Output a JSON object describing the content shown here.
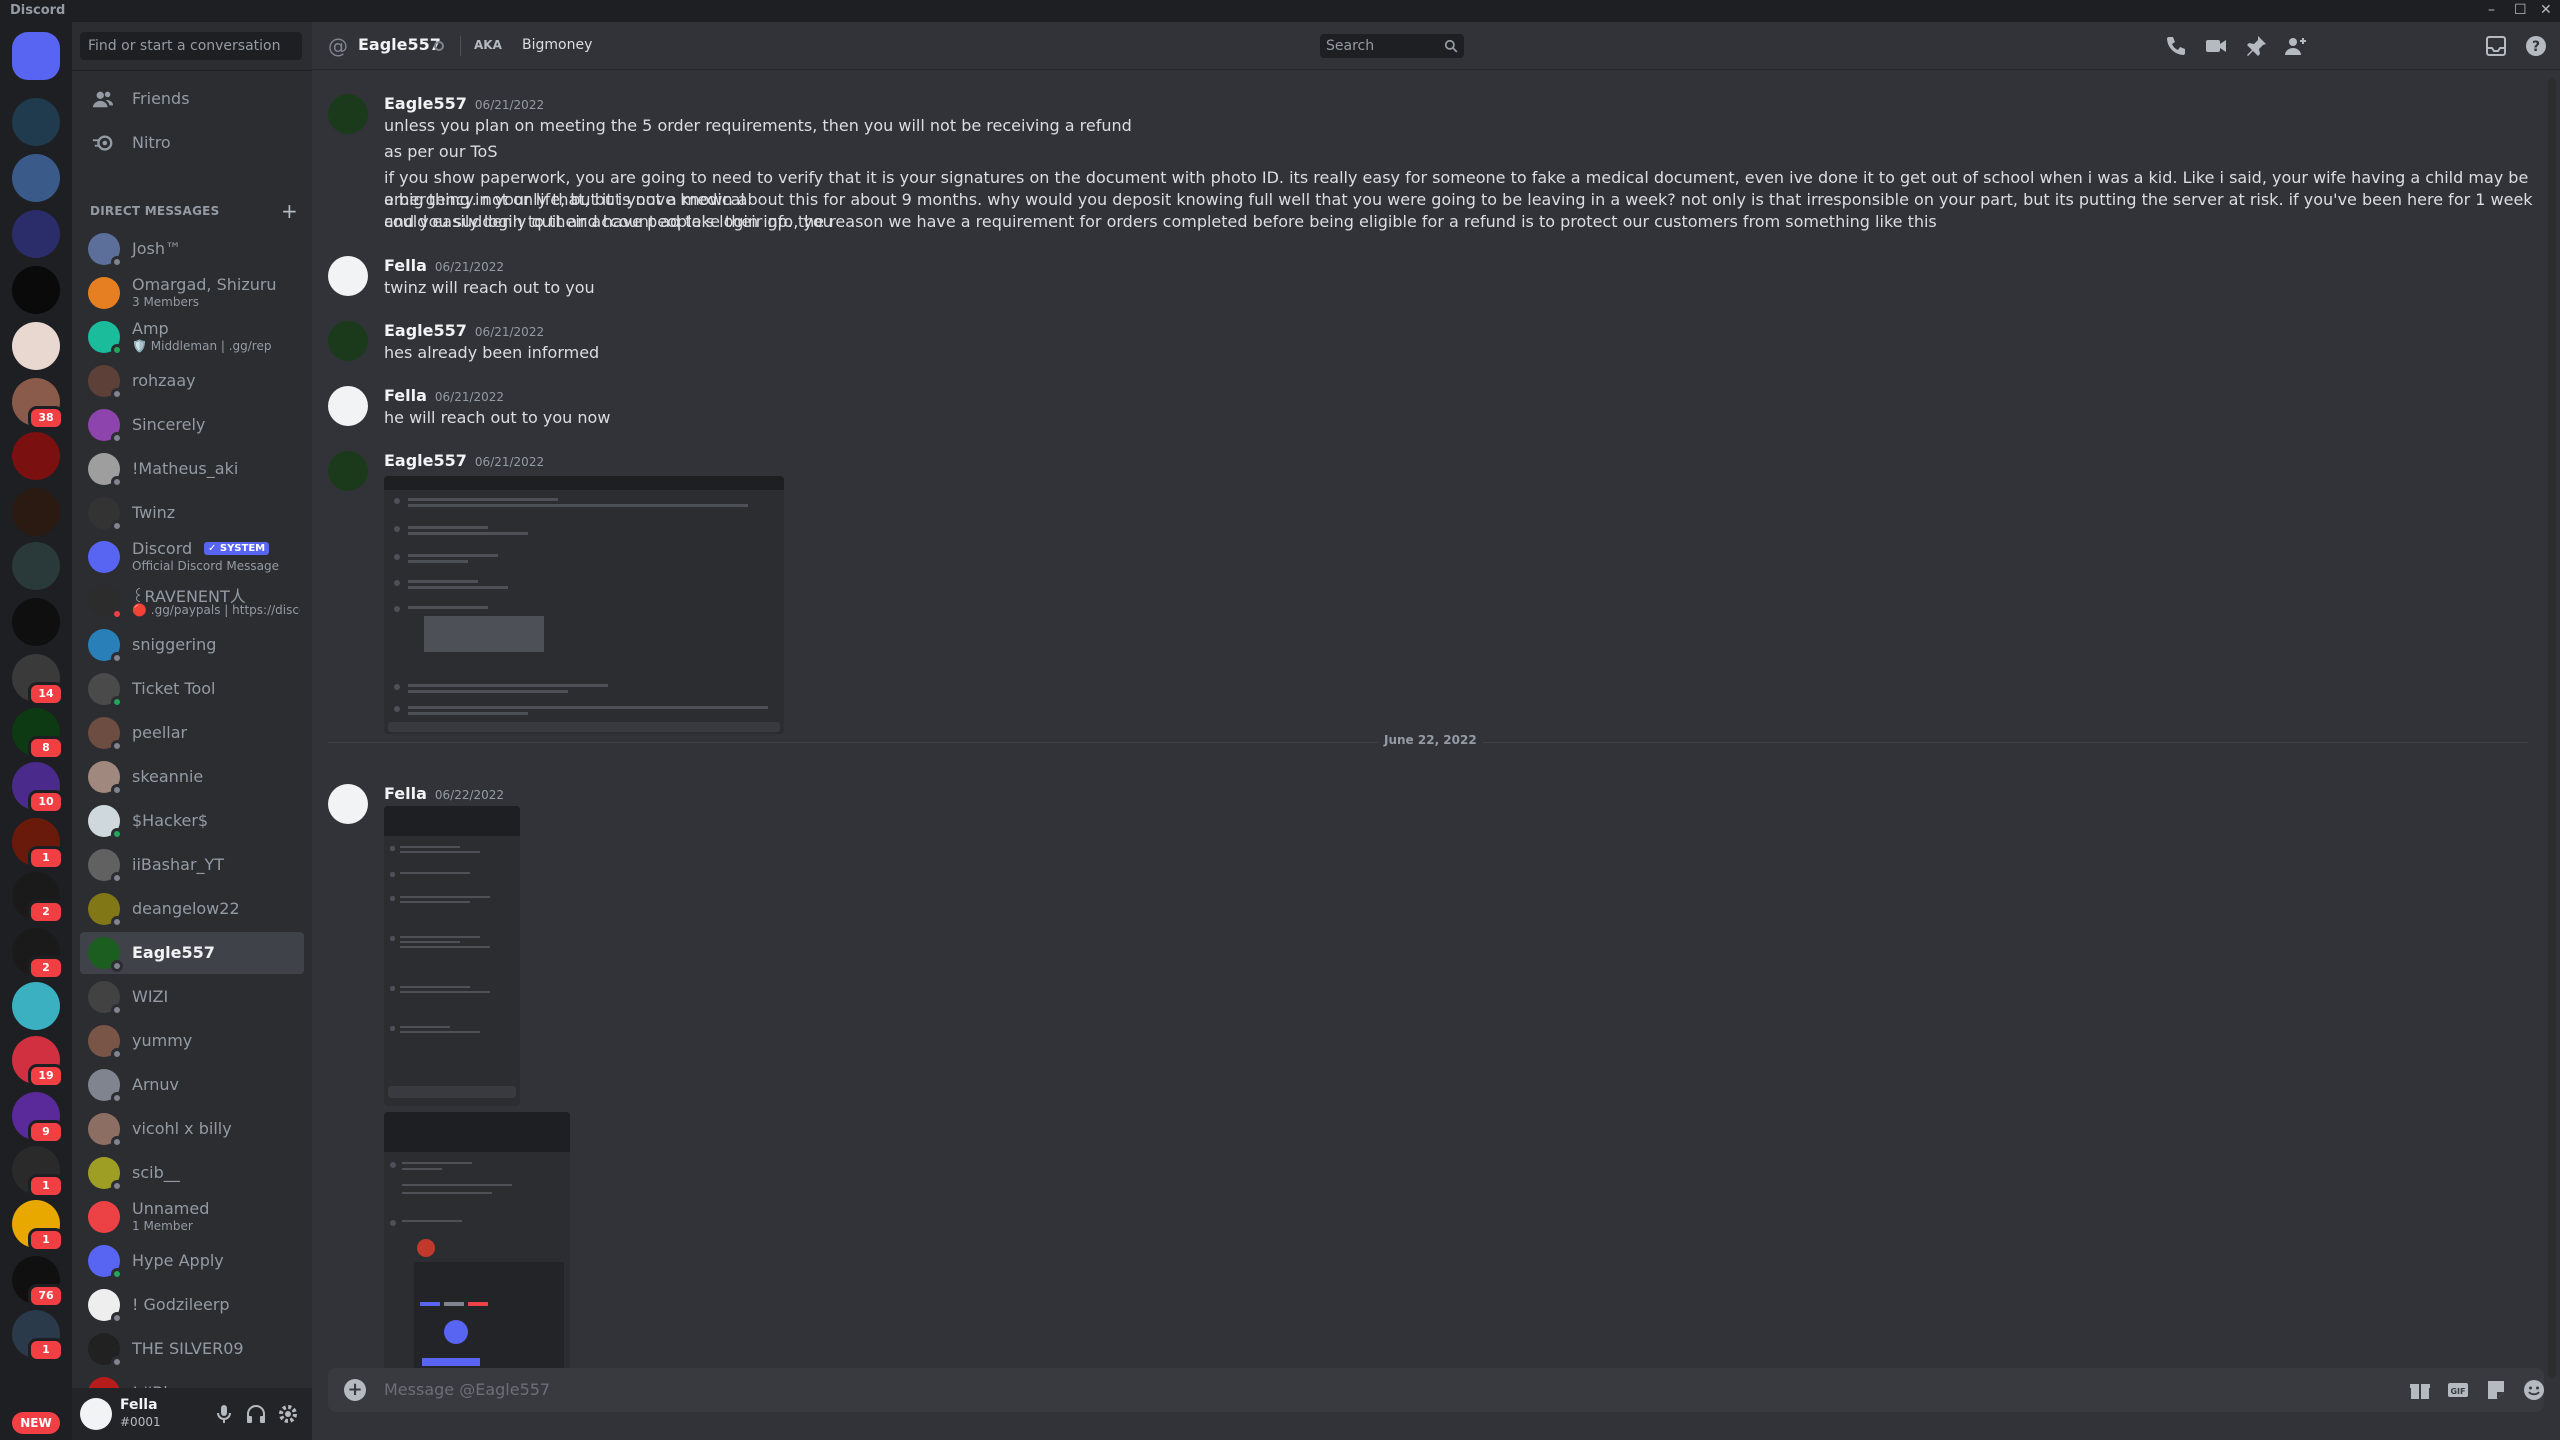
{
  "window": {
    "app_name": "Discord",
    "minimize": "–",
    "maximize": "☐",
    "close": "✕"
  },
  "sidebar": {
    "search_placeholder": "Find or start a conversation",
    "nav": [
      {
        "label": "Friends",
        "icon": "friends-icon"
      },
      {
        "label": "Nitro",
        "icon": "nitro-icon"
      }
    ],
    "dm_header": "DIRECT MESSAGES",
    "dm_add": "+",
    "dms": [
      {
        "name": "Josh™",
        "color": "#5b6f9a",
        "status": "offline"
      },
      {
        "name": "Omargad, Shizuru",
        "sub": "3 Members",
        "color": "#e67e22",
        "status": "none"
      },
      {
        "name": "Amp",
        "sub": "🛡️ Middleman | .gg/rep",
        "color": "#1abc9c",
        "status": "online"
      },
      {
        "name": "rohzaay",
        "color": "#5d4037",
        "status": "offline"
      },
      {
        "name": "Sincerely",
        "color": "#8e44ad",
        "status": "offline"
      },
      {
        "name": "!Matheus_aki",
        "color": "#9e9e9e",
        "status": "offline"
      },
      {
        "name": "Twinz",
        "color": "#333333",
        "status": "offline"
      },
      {
        "name": "Discord",
        "sub": "Official Discord Message",
        "badge": "✓ SYSTEM",
        "color": "#5865f2",
        "status": "none"
      },
      {
        "name": "꒰RAVENENT人",
        "sub": "🔴 .gg/paypals | https://discor...",
        "color": "#2c2c2c",
        "status": "dnd"
      },
      {
        "name": "sniggering",
        "color": "#2980b9",
        "status": "offline"
      },
      {
        "name": "Ticket Tool",
        "color": "#4a4a4a",
        "status": "online"
      },
      {
        "name": "peellar",
        "color": "#6d4c41",
        "status": "offline"
      },
      {
        "name": "skeannie",
        "color": "#a1887f",
        "status": "offline"
      },
      {
        "name": "$Hacker$",
        "color": "#cfd8dc",
        "status": "online"
      },
      {
        "name": "iiBashar_YT",
        "color": "#616161",
        "status": "offline"
      },
      {
        "name": "deangelow22",
        "color": "#827717",
        "status": "offline"
      },
      {
        "name": "Eagle557",
        "color": "#1b5e20",
        "status": "offline",
        "active": true
      },
      {
        "name": "WIZI",
        "color": "#424242",
        "status": "offline"
      },
      {
        "name": "yummy",
        "color": "#795548",
        "status": "offline"
      },
      {
        "name": "Arnuv",
        "color": "#80848e",
        "status": "offline"
      },
      {
        "name": "vicohl x billy",
        "color": "#8d6e63",
        "status": "offline"
      },
      {
        "name": "scib__",
        "color": "#9e9d24",
        "status": "offline"
      },
      {
        "name": "Unnamed",
        "sub": "1 Member",
        "color": "#ed4245",
        "status": "none"
      },
      {
        "name": "Hype Apply",
        "color": "#5865f2",
        "status": "online"
      },
      {
        "name": "! Godzileerp",
        "color": "#eeeeee",
        "status": "offline"
      },
      {
        "name": "THE SILVER09",
        "color": "#212121",
        "status": "offline"
      },
      {
        "name": "! ''Blazer",
        "color": "#b71c1c",
        "status": "offline"
      }
    ],
    "user": {
      "name": "Fella",
      "tag": "#0001"
    }
  },
  "servers": [
    {
      "icon": "discord-home-icon",
      "color": "#5865f2"
    },
    {
      "icon": "server-icon",
      "color": "#1f3b4d"
    },
    {
      "icon": "server-icon",
      "color": "#3a5a8a"
    },
    {
      "icon": "folder-icon",
      "color": "#2b2d6b"
    },
    {
      "icon": "server-icon",
      "color": "#0a0a0a"
    },
    {
      "icon": "server-icon",
      "color": "#e8d8d0"
    },
    {
      "icon": "server-icon",
      "color": "#8a5a4a",
      "badge": "38"
    },
    {
      "icon": "server-icon",
      "color": "#7a1010"
    },
    {
      "icon": "server-icon",
      "color": "#2b1a12"
    },
    {
      "icon": "server-icon",
      "color": "#2a3a3a"
    },
    {
      "icon": "server-icon",
      "color": "#0f0f0f"
    },
    {
      "icon": "server-icon",
      "color": "#3a3a3a",
      "badge": "14"
    },
    {
      "icon": "server-icon",
      "color": "#0d3a12",
      "badge": "8"
    },
    {
      "icon": "server-icon",
      "color": "#4a2a8a",
      "badge": "10"
    },
    {
      "icon": "server-icon",
      "color": "#6a1a0a",
      "badge": "1"
    },
    {
      "icon": "server-icon",
      "color": "#1a1a1a",
      "badge": "2"
    },
    {
      "icon": "server-icon",
      "color": "#1a1a1a",
      "badge": "2"
    },
    {
      "icon": "server-icon",
      "color": "#3ab0c0"
    },
    {
      "icon": "server-icon",
      "color": "#d03040",
      "badge": "19"
    },
    {
      "icon": "server-icon",
      "color": "#5a2a9a",
      "badge": "9"
    },
    {
      "icon": "server-icon",
      "color": "#2a2a2a",
      "badge": "1"
    },
    {
      "icon": "server-icon",
      "color": "#e8a800",
      "badge": "1"
    },
    {
      "icon": "server-icon",
      "color": "#101010",
      "badge": "76"
    },
    {
      "icon": "server-icon",
      "color": "#2a3a4a",
      "badge": "1"
    }
  ],
  "new_label": "NEW",
  "header": {
    "at": "@",
    "title": "Eagle557",
    "aka_label": "AKA",
    "aka_name": "Bigmoney",
    "search_placeholder": "Search",
    "icons": [
      "phone-call-icon",
      "video-call-icon",
      "pin-icon",
      "add-friend-icon",
      "search-icon",
      "inbox-icon",
      "help-icon"
    ]
  },
  "messages": [
    {
      "author": "Eagle557",
      "time": "06/21/2022",
      "lines": [
        "unless you plan on meeting the 5 order requirements, then you will not be receiving a refund",
        "as per our ToS",
        "if you show paperwork, you are going to need to verify that it is your signatures on the document with photo ID. its really easy for someone to fake a medical document, even ive done it to get out of school when i was a kid. Like i said, your wife having a child may be a big thing in your life, but it is not a medical",
        "emergency. not only that, but youve known about this for about 9 months. why would you deposit knowing full well that you were going to be leaving in a week? not only is that irresponsible on your part, but its putting the server at risk. if you've been here for 1 week and you suddenly quit and have people's login info, you",
        "could easily login to their account ad take their gp. the reason we have a requirement for orders completed before being eligible for a refund is to protect our customers from something like this"
      ]
    },
    {
      "author": "Fella",
      "time": "06/21/2022",
      "lines": [
        "twinz will reach out to you"
      ]
    },
    {
      "author": "Eagle557",
      "time": "06/21/2022",
      "lines": [
        "hes already been informed"
      ]
    },
    {
      "author": "Fella",
      "time": "06/21/2022",
      "lines": [
        "he will reach out to you now"
      ]
    },
    {
      "author": "Eagle557",
      "time": "06/21/2022",
      "lines": []
    },
    {
      "author": "Fella",
      "time": "06/22/2022",
      "lines": []
    }
  ],
  "date_divider": "June 22, 2022",
  "composer": {
    "add": "+",
    "placeholder": "Message @Eagle557",
    "icons": [
      "gift-icon",
      "gif-icon",
      "sticker-icon",
      "emoji-icon"
    ]
  }
}
